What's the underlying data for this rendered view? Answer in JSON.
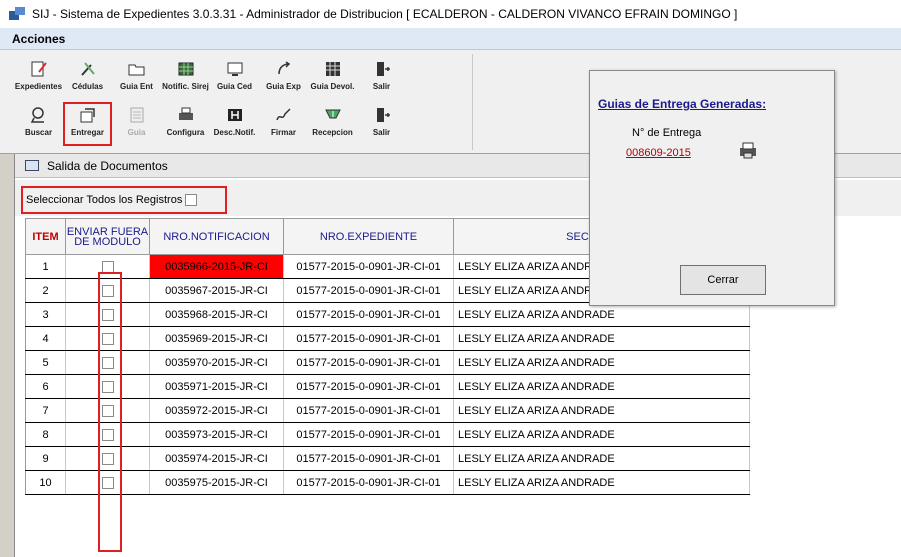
{
  "window": {
    "title": "SIJ - Sistema de Expedientes 3.0.3.31 - Administrador de Distribucion  [ ECALDERON - CALDERON VIVANCO EFRAIN DOMINGO ]"
  },
  "menu": {
    "acciones": "Acciones"
  },
  "toolbar": {
    "row1": [
      {
        "label": "Expedientes",
        "icon": "edit-document-icon"
      },
      {
        "label": "Cédulas",
        "icon": "tools-icon"
      },
      {
        "label": "Guia Ent",
        "icon": "folder-open-icon"
      },
      {
        "label": "Notific. Sirej",
        "icon": "grid-icon"
      },
      {
        "label": "Guia Ced",
        "icon": "monitor-icon"
      },
      {
        "label": "Guia Exp",
        "icon": "arrow-icon"
      },
      {
        "label": "Guia Devol.",
        "icon": "table-icon"
      },
      {
        "label": "Salir",
        "icon": "exit-icon"
      }
    ],
    "row2": [
      {
        "label": "Buscar",
        "icon": "search-icon"
      },
      {
        "label": "Entregar",
        "icon": "deliver-icon"
      },
      {
        "label": "Guia",
        "icon": "guide-icon"
      },
      {
        "label": "Configura",
        "icon": "printer-icon"
      },
      {
        "label": "Desc.Notif.",
        "icon": "download-icon"
      },
      {
        "label": "Firmar",
        "icon": "sign-icon"
      },
      {
        "label": "Recepcion",
        "icon": "reception-icon"
      },
      {
        "label": "Salir",
        "icon": "exit-icon"
      }
    ]
  },
  "panel": {
    "title": "Salida de Documentos",
    "select_all_label": "Seleccionar Todos los Registros"
  },
  "grid": {
    "headers": {
      "item": "ITEM",
      "enviar": "ENVIAR FUERA DE MODULO",
      "notif": "NRO.NOTIFICACION",
      "exp": "NRO.EXPEDIENTE",
      "sec": "SECRETARIO"
    },
    "rows": [
      {
        "item": "1",
        "notif": "0035966-2015-JR-CI",
        "exp": "01577-2015-0-0901-JR-CI-01",
        "sec": "LESLY ELIZA ARIZA ANDRADE"
      },
      {
        "item": "2",
        "notif": "0035967-2015-JR-CI",
        "exp": "01577-2015-0-0901-JR-CI-01",
        "sec": "LESLY ELIZA ARIZA ANDRADE"
      },
      {
        "item": "3",
        "notif": "0035968-2015-JR-CI",
        "exp": "01577-2015-0-0901-JR-CI-01",
        "sec": "LESLY ELIZA ARIZA ANDRADE"
      },
      {
        "item": "4",
        "notif": "0035969-2015-JR-CI",
        "exp": "01577-2015-0-0901-JR-CI-01",
        "sec": "LESLY ELIZA ARIZA ANDRADE"
      },
      {
        "item": "5",
        "notif": "0035970-2015-JR-CI",
        "exp": "01577-2015-0-0901-JR-CI-01",
        "sec": "LESLY ELIZA ARIZA ANDRADE"
      },
      {
        "item": "6",
        "notif": "0035971-2015-JR-CI",
        "exp": "01577-2015-0-0901-JR-CI-01",
        "sec": "LESLY ELIZA ARIZA ANDRADE"
      },
      {
        "item": "7",
        "notif": "0035972-2015-JR-CI",
        "exp": "01577-2015-0-0901-JR-CI-01",
        "sec": "LESLY ELIZA ARIZA ANDRADE"
      },
      {
        "item": "8",
        "notif": "0035973-2015-JR-CI",
        "exp": "01577-2015-0-0901-JR-CI-01",
        "sec": "LESLY ELIZA ARIZA ANDRADE"
      },
      {
        "item": "9",
        "notif": "0035974-2015-JR-CI",
        "exp": "01577-2015-0-0901-JR-CI-01",
        "sec": "LESLY ELIZA ARIZA ANDRADE"
      },
      {
        "item": "10",
        "notif": "0035975-2015-JR-CI",
        "exp": "01577-2015-0-0901-JR-CI-01",
        "sec": "LESLY ELIZA ARIZA ANDRADE"
      }
    ]
  },
  "popup": {
    "title": "Guias de Entrega Generadas:",
    "label": "N° de Entrega",
    "link": "008609-2015",
    "close": "Cerrar"
  }
}
